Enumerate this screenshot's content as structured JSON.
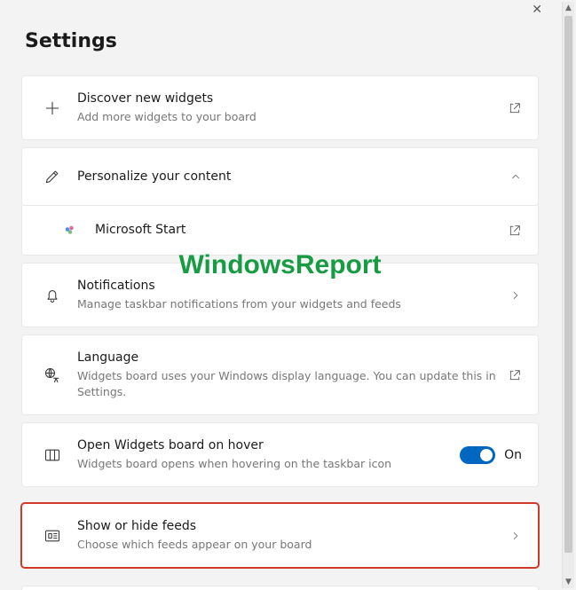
{
  "header": {
    "title": "Settings"
  },
  "items": {
    "discover": {
      "title": "Discover new widgets",
      "subtitle": "Add more widgets to your board"
    },
    "personalize": {
      "title": "Personalize your content"
    },
    "msstart": {
      "title": "Microsoft Start"
    },
    "notifications": {
      "title": "Notifications",
      "subtitle": "Manage taskbar notifications from your widgets and feeds"
    },
    "language": {
      "title": "Language",
      "subtitle": "Widgets board uses your Windows display language. You can update this in Settings."
    },
    "hover": {
      "title": "Open Widgets board on hover",
      "subtitle": "Widgets board opens when hovering on the taskbar icon",
      "toggle_label": "On",
      "toggle_on": true
    },
    "feeds": {
      "title": "Show or hide feeds",
      "subtitle": "Choose which feeds appear on your board"
    }
  },
  "watermark": "WindowsReport"
}
